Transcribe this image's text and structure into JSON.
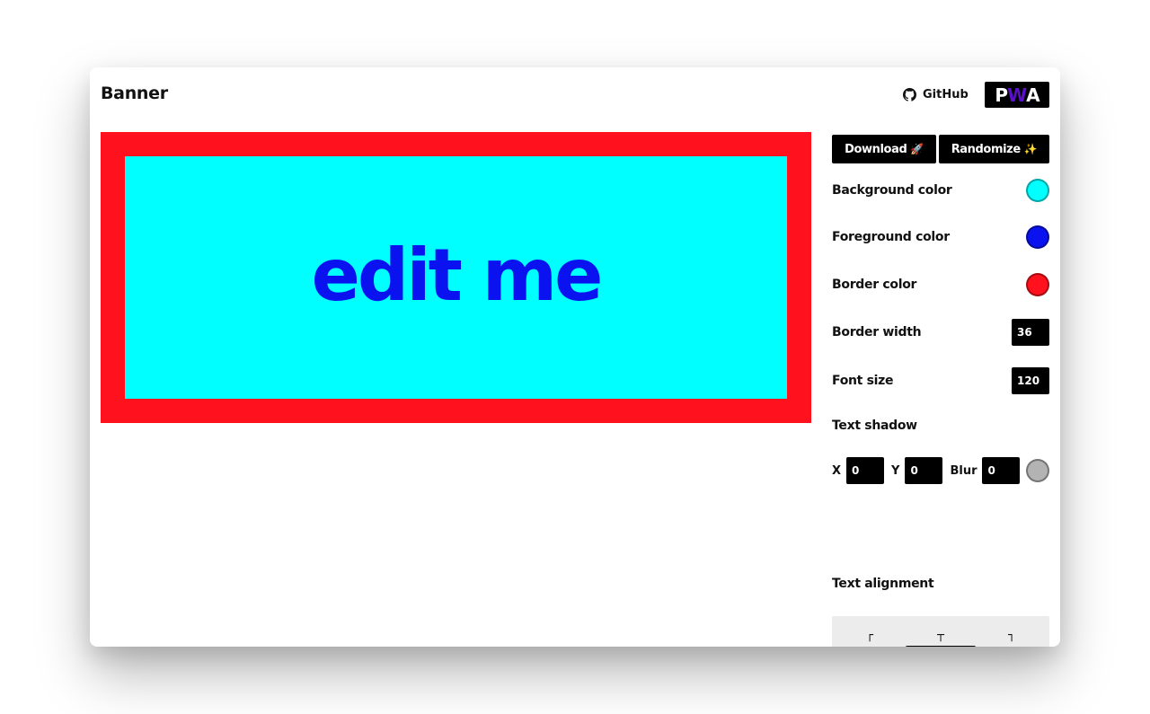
{
  "app": {
    "title": "Banner"
  },
  "header": {
    "github_label": "GitHub",
    "pwa_left": "P",
    "pwa_mid": "W",
    "pwa_right": "A"
  },
  "banner": {
    "text": "edit me",
    "background_color": "#00FFFF",
    "foreground_color": "#0A12F0",
    "border_color": "#FF111D",
    "border_width": "36",
    "font_size": "120"
  },
  "actions": {
    "download_label": "Download",
    "download_emoji": "🚀",
    "randomize_label": "Randomize",
    "randomize_emoji": "✨"
  },
  "settings": {
    "background_color_label": "Background color",
    "foreground_color_label": "Foreground color",
    "border_color_label": "Border color",
    "border_width_label": "Border width",
    "font_size_label": "Font size",
    "text_shadow_label": "Text shadow",
    "text_alignment_label": "Text alignment"
  },
  "text_shadow": {
    "x_label": "X",
    "x_value": "0",
    "y_label": "Y",
    "y_value": "0",
    "blur_label": "Blur",
    "blur_value": "0",
    "color": "#B3B3B3"
  },
  "alignment": {
    "selected": "center",
    "glyphs": {
      "top_left": "┌",
      "top": "┬",
      "top_right": "┐",
      "left": "├",
      "center": "┼",
      "right": "┤",
      "bottom_left": "└",
      "bottom": "┴",
      "bottom_right": "┘"
    }
  }
}
